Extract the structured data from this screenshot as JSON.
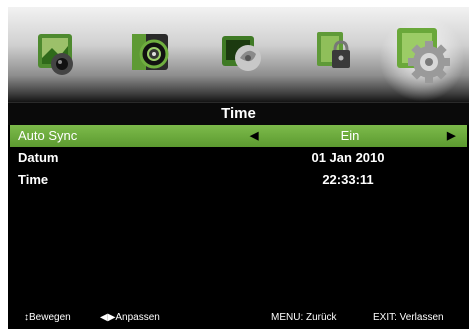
{
  "menu": {
    "title": "Time",
    "tabs": [
      {
        "icon": "picture-icon"
      },
      {
        "icon": "sound-icon"
      },
      {
        "icon": "channel-icon"
      },
      {
        "icon": "lock-icon"
      },
      {
        "icon": "settings-icon",
        "active": true
      }
    ]
  },
  "rows": [
    {
      "label": "Auto Sync",
      "value": "Ein",
      "selected": true
    },
    {
      "label": "Datum",
      "value": "01 Jan 2010"
    },
    {
      "label": "Time",
      "value": "22:33:11"
    }
  ],
  "footer": {
    "move": "↕Bewegen",
    "adjust": "◀▶Anpassen",
    "menu": "MENU: Zurück",
    "exit": "EXIT: Verlassen"
  },
  "colors": {
    "selected_row": "#6aab3c",
    "background": "#000000",
    "text": "#ffffff"
  }
}
